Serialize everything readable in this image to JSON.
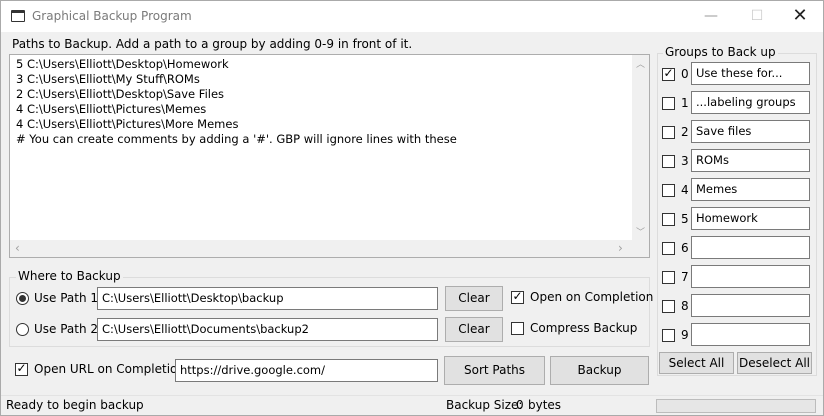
{
  "window": {
    "title": "Graphical Backup Program",
    "controls": {
      "minimize": "—",
      "maximize": "☐",
      "close": "✕"
    }
  },
  "paths": {
    "label": "Paths to Backup. Add a path to a group by adding 0-9 in front of it.",
    "lines": [
      "5 C:\\Users\\Elliott\\Desktop\\Homework",
      "3 C:\\Users\\Elliott\\My Stuff\\ROMs",
      "2 C:\\Users\\Elliott\\Desktop\\Save Files",
      "4 C:\\Users\\Elliott\\Pictures\\Memes",
      "4 C:\\Users\\Elliott\\Pictures\\More Memes",
      "# You can create comments by adding a '#'. GBP will ignore lines with these"
    ]
  },
  "where": {
    "title": "Where to Backup",
    "path1": {
      "label": "Use Path 1:",
      "value": "C:\\Users\\Elliott\\Desktop\\backup",
      "selected": true
    },
    "path2": {
      "label": "Use Path 2:",
      "value": "C:\\Users\\Elliott\\Documents\\backup2",
      "selected": false
    },
    "clear_label": "Clear",
    "open_on_completion": {
      "label": "Open on Completion",
      "checked": true
    },
    "compress_backup": {
      "label": "Compress Backup",
      "checked": false
    }
  },
  "url": {
    "label": "Open URL on Completion:",
    "checked": true,
    "value": "https://drive.google.com/"
  },
  "buttons": {
    "sort_paths": "Sort Paths",
    "backup": "Backup"
  },
  "groups": {
    "title": "Groups to Back up",
    "items": [
      {
        "num": "0",
        "checked": true,
        "value": "Use these for..."
      },
      {
        "num": "1",
        "checked": false,
        "value": "...labeling groups"
      },
      {
        "num": "2",
        "checked": false,
        "value": "Save files"
      },
      {
        "num": "3",
        "checked": false,
        "value": "ROMs"
      },
      {
        "num": "4",
        "checked": false,
        "value": "Memes"
      },
      {
        "num": "5",
        "checked": false,
        "value": "Homework"
      },
      {
        "num": "6",
        "checked": false,
        "value": ""
      },
      {
        "num": "7",
        "checked": false,
        "value": ""
      },
      {
        "num": "8",
        "checked": false,
        "value": ""
      },
      {
        "num": "9",
        "checked": false,
        "value": ""
      }
    ],
    "select_all": "Select All",
    "deselect_all": "Deselect All"
  },
  "status": {
    "text": "Ready to begin backup",
    "size_label": "Backup Size:",
    "size_value": "0",
    "size_unit": "bytes",
    "progress": 0
  },
  "glyphs": {
    "check": "✓",
    "up": "︿",
    "down": "﹀",
    "left": "‹",
    "right": "›"
  }
}
